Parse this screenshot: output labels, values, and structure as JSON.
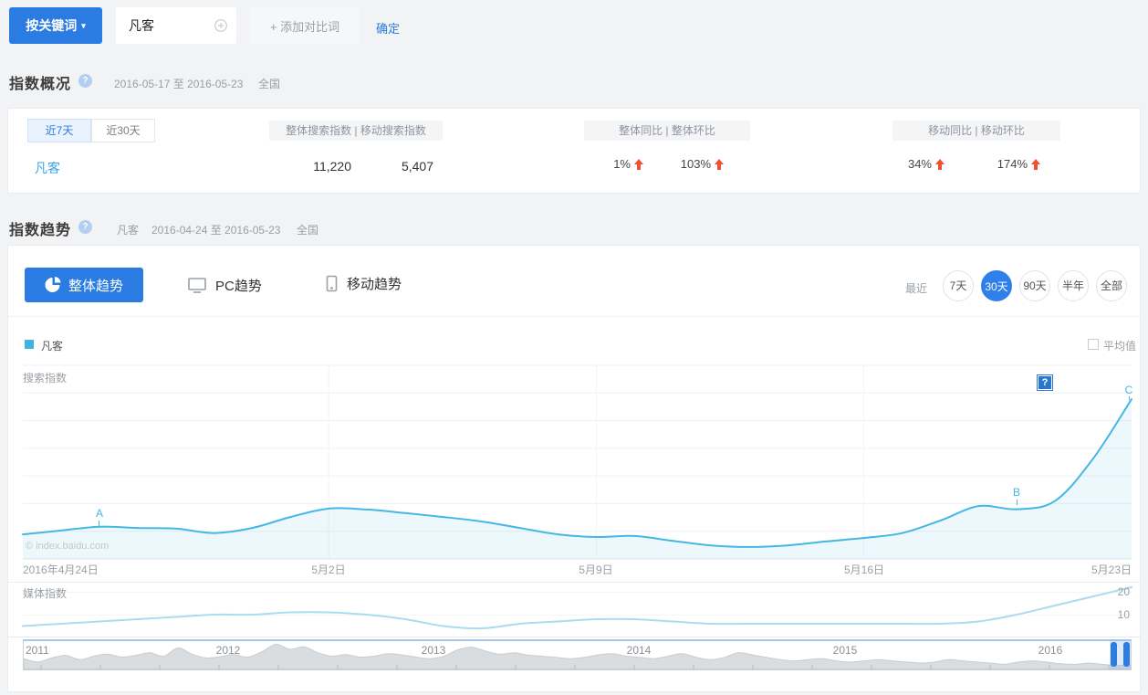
{
  "colors": {
    "primary_blue": "#2b7ce2",
    "active_circle_blue": "#2f80ea",
    "link_blue": "#2a7ae2",
    "keyword_blue": "#3da4e6",
    "trend_line_cyan": "#45b7e5",
    "media_line_cyan": "#a9dcef",
    "legend_square_cyan": "#3eb3e0",
    "arrow_orange": "#f0502f",
    "timeline_fill_gray": "#dadde0"
  },
  "topbar": {
    "mode_button": "按关键词",
    "mode_caret": "▾",
    "keyword": "凡客",
    "add_compare": "+ 添加对比词",
    "confirm": "确定"
  },
  "overview": {
    "title": "指数概况",
    "help": "?",
    "date_range": "2016-05-17 至 2016-05-23",
    "region": "全国",
    "tab_7d": "近7天",
    "tab_30d": "近30天",
    "header_search": "整体搜索指数  |  移动搜索指数",
    "header_overall": "整体同比  |  整体环比",
    "header_mobile": "移动同比  |  移动环比",
    "keyword": "凡客",
    "overall_search_index": "11,220",
    "mobile_search_index": "5,407",
    "overall_yoy": "1%",
    "overall_mom": "103%",
    "mobile_yoy": "34%",
    "mobile_mom": "174%"
  },
  "trend": {
    "title": "指数趋势",
    "help": "?",
    "keyword": "凡客",
    "date_range": "2016-04-24 至 2016-05-23",
    "region": "全国",
    "tab_overall": "整体趋势",
    "tab_pc": "PC趋势",
    "tab_mobile": "移动趋势",
    "recent": "最近",
    "range_7d": "7天",
    "range_30d": "30天",
    "range_90d": "90天",
    "range_half_year": "半年",
    "range_all": "全部",
    "legend_keyword": "凡客",
    "average_label": "平均值",
    "search_index_label": "搜索指数",
    "media_index_label": "媒体指数",
    "chart_help": "?",
    "watermark": "© index.baidu.com",
    "ann_a": "A",
    "ann_b": "B",
    "ann_c": "C",
    "x_tick_1": "2016年4月24日",
    "x_tick_2": "5月2日",
    "x_tick_3": "5月9日",
    "x_tick_4": "5月16日",
    "x_tick_5": "5月23日",
    "media_tick_20": "20",
    "media_tick_10": "10",
    "year_2011": "2011",
    "year_2012": "2012",
    "year_2013": "2013",
    "year_2014": "2014",
    "year_2015": "2015",
    "year_2016": "2016"
  },
  "chart_data": [
    {
      "id": "search_trend",
      "type": "area",
      "title": "搜索指数 (整体趋势, 近30天)",
      "x_ticks": [
        "2016年4月24日",
        "5月2日",
        "5月9日",
        "5月16日",
        "5月23日"
      ],
      "x_range": [
        "2016-04-24",
        "2016-05-23"
      ],
      "ylim": [
        0,
        30000
      ],
      "grid": true,
      "legend": [
        "凡客"
      ],
      "line_color": "#45b7e5",
      "values": [
        3800,
        4400,
        5000,
        4800,
        4700,
        4000,
        4800,
        6500,
        7800,
        7650,
        7100,
        6500,
        5800,
        4800,
        3800,
        3400,
        3550,
        2800,
        2100,
        1850,
        2100,
        2700,
        3250,
        4000,
        5950,
        8200,
        7700,
        9000,
        15600,
        24750
      ],
      "annotations": [
        {
          "label": "A",
          "index": 2
        },
        {
          "label": "B",
          "index": 25
        },
        {
          "label": "C",
          "index": 29
        }
      ]
    },
    {
      "id": "media_trend",
      "type": "line",
      "title": "媒体指数",
      "ylim": [
        0,
        23
      ],
      "y_ticks": [
        10,
        20
      ],
      "line_color": "#a9dcef",
      "values": [
        5,
        6,
        7,
        8,
        9,
        10,
        10,
        11,
        11,
        10,
        8,
        5,
        4,
        6,
        7,
        8,
        8,
        7,
        6,
        6,
        6,
        6,
        6,
        6,
        6,
        7,
        10,
        14,
        18,
        22
      ]
    },
    {
      "id": "timeline_overview",
      "type": "area",
      "title": "全部时间缩略图",
      "x_ticks": [
        "2011",
        "2012",
        "2013",
        "2014",
        "2015",
        "2016"
      ],
      "fill_color": "#dadde0",
      "values": [
        0.42,
        0.28,
        0.45,
        0.55,
        0.38,
        0.52,
        0.6,
        0.48,
        0.55,
        0.66,
        0.52,
        0.85,
        0.6,
        0.45,
        0.5,
        0.58,
        0.48,
        0.7,
        1.0,
        0.8,
        0.9,
        0.66,
        0.52,
        0.58,
        0.48,
        0.52,
        0.62,
        0.57,
        0.48,
        0.42,
        0.52,
        0.78,
        0.88,
        0.72,
        0.6,
        0.66,
        0.56,
        0.52,
        0.47,
        0.42,
        0.47,
        0.57,
        0.62,
        0.52,
        0.47,
        0.42,
        0.52,
        0.62,
        0.47,
        0.38,
        0.47,
        0.66,
        0.57,
        0.47,
        0.38,
        0.33,
        0.38,
        0.42,
        0.33,
        0.28,
        0.33,
        0.38,
        0.33,
        0.28,
        0.24,
        0.28,
        0.38,
        0.33,
        0.28,
        0.24,
        0.19,
        0.28,
        0.33,
        0.28,
        0.21,
        0.19,
        0.24,
        0.19,
        0.14,
        0.17
      ]
    }
  ]
}
